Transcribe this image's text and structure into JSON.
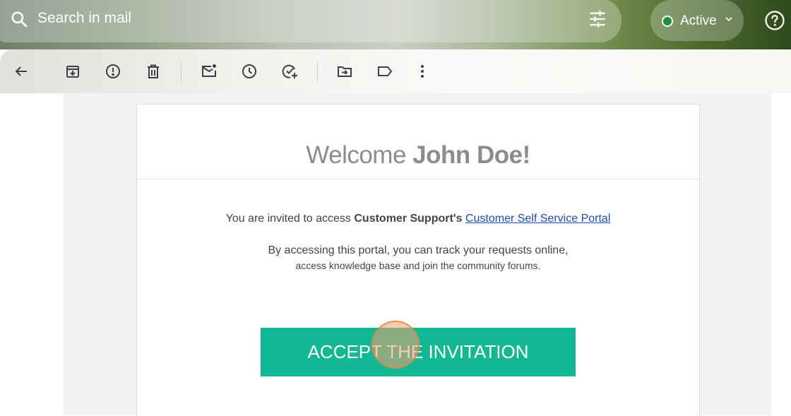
{
  "search": {
    "placeholder": "Search in mail",
    "icon": "search-icon",
    "options_icon": "tune-icon"
  },
  "status": {
    "label": "Active",
    "dot_color": "#1e8e3e"
  },
  "help": {
    "icon": "help-icon"
  },
  "toolbar": {
    "items": [
      {
        "name": "back-button",
        "icon": "arrow-left-icon"
      },
      {
        "name": "archive-button",
        "icon": "archive-icon"
      },
      {
        "name": "report-spam-button",
        "icon": "report-icon"
      },
      {
        "name": "delete-button",
        "icon": "trash-icon"
      },
      {
        "name": "mark-unread-button",
        "icon": "mail-unread-icon"
      },
      {
        "name": "snooze-button",
        "icon": "clock-icon"
      },
      {
        "name": "add-to-tasks-button",
        "icon": "task-add-icon"
      },
      {
        "name": "move-to-button",
        "icon": "move-folder-icon"
      },
      {
        "name": "labels-button",
        "icon": "label-icon"
      },
      {
        "name": "more-button",
        "icon": "more-vert-icon"
      }
    ]
  },
  "email": {
    "welcome_prefix": "Welcome",
    "welcome_name": "John Doe!",
    "invite_prefix": "You are invited to access",
    "invite_org": "Customer Support's",
    "portal_link": "Customer Self Service Portal",
    "desc_line1": "By accessing this portal, you can track your requests online,",
    "desc_line2": "access knowledge base and join the community forums.",
    "accept_label": "ACCEPT THE INVITATION",
    "accept_color": "#12b794"
  }
}
